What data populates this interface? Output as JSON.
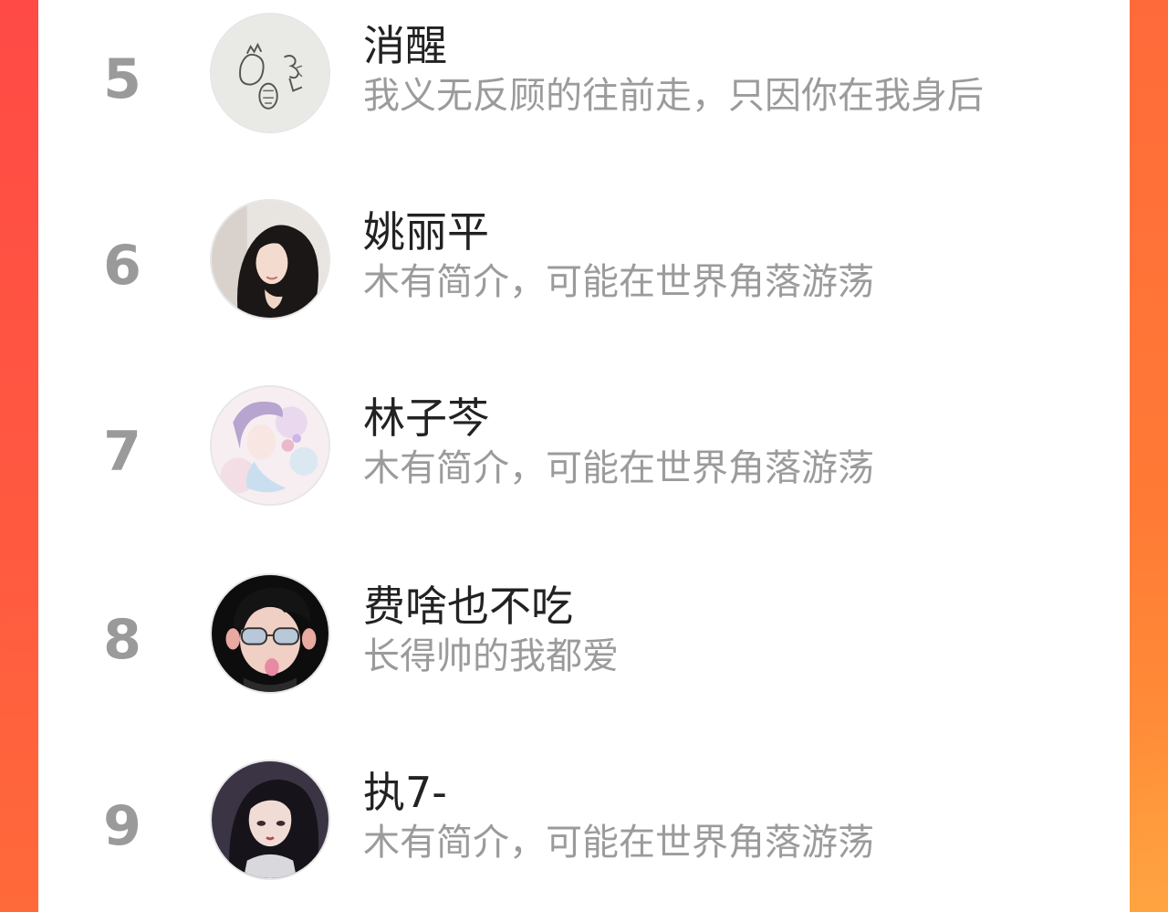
{
  "colors": {
    "accent_left": "#ff4a45",
    "accent_right": "#ff7a35",
    "rank_number": "#9a9a9a",
    "name_text": "#222222",
    "bio_text": "#9b9b9b"
  },
  "ranking": {
    "items": [
      {
        "rank": "5",
        "name": "消醒",
        "bio": "我义无反顾的往前走，只因你在我身后",
        "avatar": "sketch-drawing-avatar"
      },
      {
        "rank": "6",
        "name": "姚丽平",
        "bio": "木有简介，可能在世界角落游荡",
        "avatar": "girl-photo-avatar"
      },
      {
        "rank": "7",
        "name": "林子芩",
        "bio": "木有简介，可能在世界角落游荡",
        "avatar": "pastel-illustration-avatar"
      },
      {
        "rank": "8",
        "name": "费啥也不吃",
        "bio": "长得帅的我都爱",
        "avatar": "cartoon-boy-avatar"
      },
      {
        "rank": "9",
        "name": "执7-",
        "bio": "木有简介，可能在世界角落游荡",
        "avatar": "anime-girl-avatar"
      }
    ]
  }
}
